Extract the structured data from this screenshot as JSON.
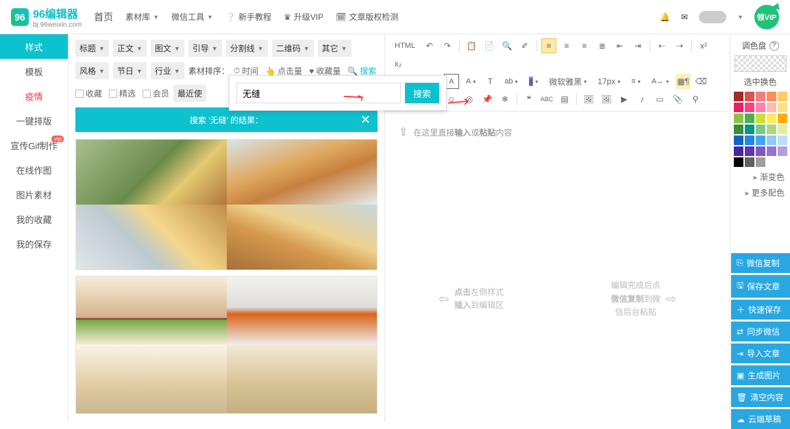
{
  "logo": {
    "brand": "96编辑器",
    "sub": "bj.96weixin.com",
    "glyph": "96"
  },
  "nav": {
    "home": "首页",
    "material": "素材库",
    "wechat": "微信工具",
    "tutorial": "新手教程",
    "upgrade": "升级VIP",
    "check": "文章版权检测"
  },
  "vip_badge": "领VIP",
  "sidebar": [
    {
      "label": "样式",
      "key": "style",
      "active": true
    },
    {
      "label": "模板",
      "key": "template"
    },
    {
      "label": "疫情",
      "key": "epidemic",
      "red": true
    },
    {
      "label": "一键排版",
      "key": "oneclick"
    },
    {
      "label": "宣传Gif制作",
      "key": "gif",
      "vip": true,
      "vip_text": "vip"
    },
    {
      "label": "在线作图",
      "key": "draw"
    },
    {
      "label": "图片素材",
      "key": "pic"
    },
    {
      "label": "我的收藏",
      "key": "fav"
    },
    {
      "label": "我的保存",
      "key": "save"
    }
  ],
  "filters": {
    "row1": [
      "标题",
      "正文",
      "图文",
      "引导",
      "分割线",
      "二维码",
      "其它"
    ],
    "row2": [
      "风格",
      "节日",
      "行业"
    ],
    "sort_label": "素材排序：",
    "sort_opts": [
      {
        "label": "时间",
        "icon": "⏱"
      },
      {
        "label": "点击量",
        "icon": "👆"
      },
      {
        "label": "收藏量",
        "icon": "♥"
      },
      {
        "label": "搜索",
        "icon": "🔍",
        "active": true
      }
    ],
    "row3": [
      {
        "label": "收藏"
      },
      {
        "label": "精选"
      },
      {
        "label": "会员"
      }
    ],
    "recent": "最近使"
  },
  "search": {
    "value": "无缝",
    "btn": "搜索"
  },
  "results_header": "搜索 '无缝' 的结果：",
  "badge_icon": "✦",
  "editor": {
    "placeholder_prefix": "在这里直接",
    "placeholder_bold1": "输入",
    "placeholder_mid": "或",
    "placeholder_bold2": "粘贴",
    "placeholder_suffix": "内容",
    "hint_left_1": "点击",
    "hint_left_2": "左侧样式",
    "hint_left_3": "插入",
    "hint_left_4": "到编辑区",
    "hint_right_1": "编辑完成后点",
    "hint_right_2": "微信复制",
    "hint_right_3": "到微",
    "hint_right_4": "信后台粘贴",
    "font_family": "微软雅黑",
    "font_size": "17px"
  },
  "toolbar": {
    "html": "HTML"
  },
  "rightbar": {
    "title": "调色盘",
    "q": "?",
    "select_label": "选中换色",
    "gradient": "渐变色",
    "more": "更多配色"
  },
  "palette": [
    "#a52a2a",
    "#d9534f",
    "#f08080",
    "#ff8c5a",
    "#ffcc66",
    "#e91e63",
    "#ff4081",
    "#ff80ab",
    "#ffbcaf",
    "#ffe082",
    "#8bc34a",
    "#4caf50",
    "#cddc39",
    "#ffee58",
    "#ffab00",
    "#388e3c",
    "#009688",
    "#81c784",
    "#aed581",
    "#e6ee9c",
    "#1565c0",
    "#1e88e5",
    "#42a5f5",
    "#90caf9",
    "#bbdefb",
    "#4527a0",
    "#5e35b1",
    "#7e57c2",
    "#9575cd",
    "#b39ddb",
    "#000000",
    "#616161",
    "#9e9e9e",
    "#ffffff",
    "#ffffff"
  ],
  "actions": [
    {
      "icon": "⎘",
      "label": "微信复制"
    },
    {
      "icon": "🖫",
      "label": "保存文章"
    },
    {
      "icon": "＋",
      "label": "快速保存"
    },
    {
      "icon": "⇄",
      "label": "同步微信"
    },
    {
      "icon": "⇥",
      "label": "导入文章"
    },
    {
      "icon": "▣",
      "label": "生成图片"
    },
    {
      "icon": "🗑",
      "label": "清空内容"
    },
    {
      "icon": "☁",
      "label": "云端草稿"
    }
  ]
}
